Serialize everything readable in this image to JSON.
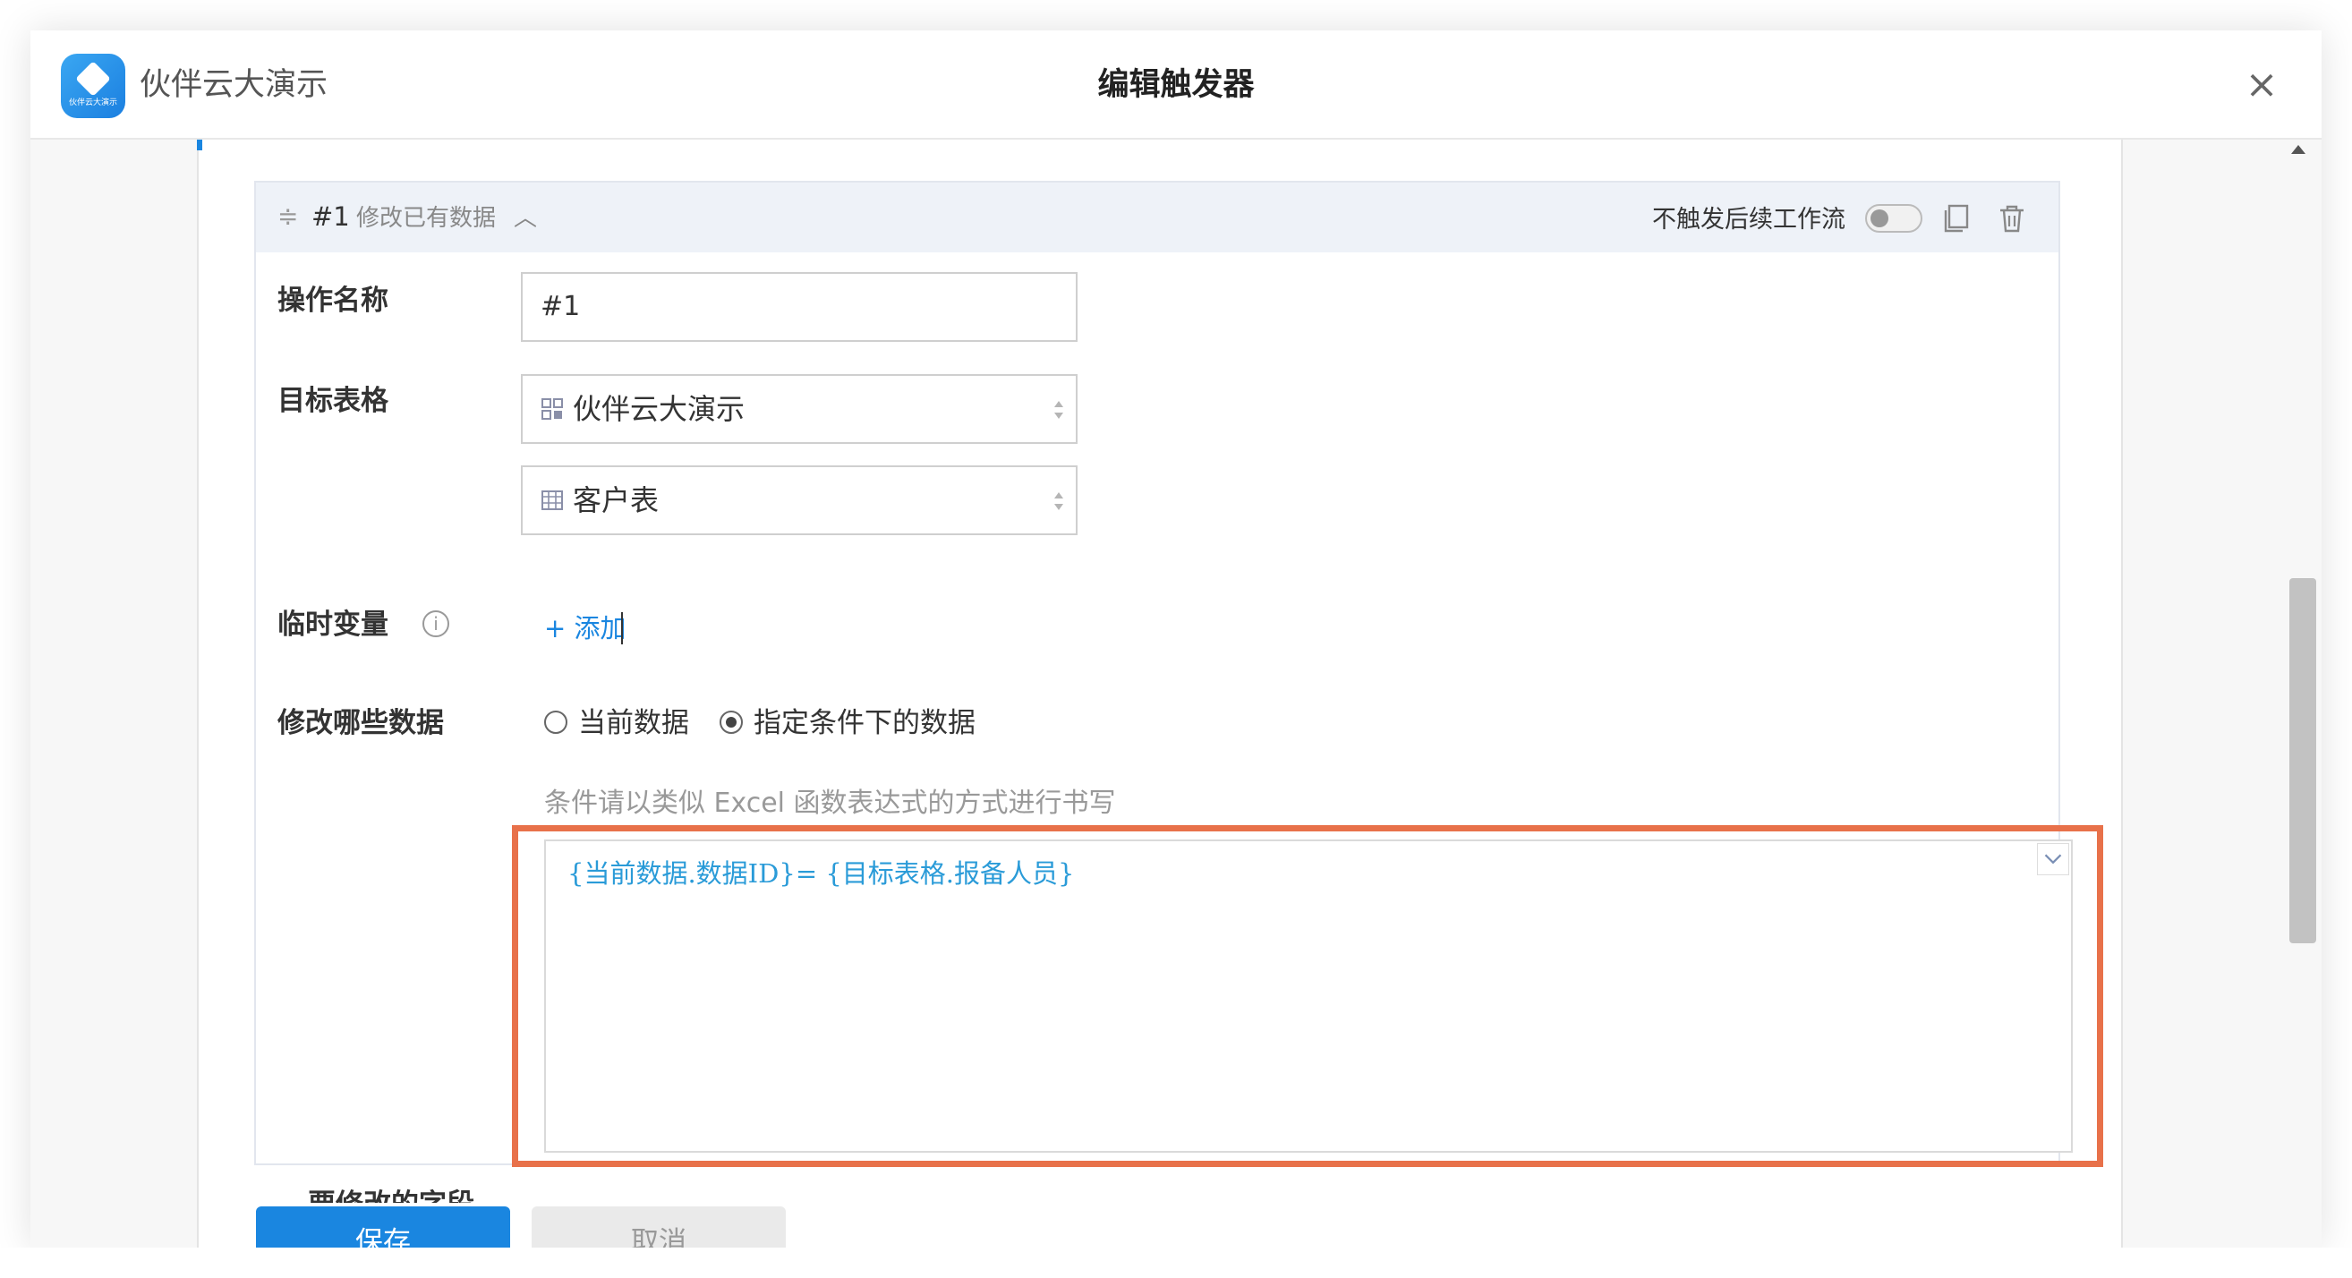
{
  "app": {
    "name": "伙伴云大演示",
    "logo_caption": "伙伴云大演示"
  },
  "dialog": {
    "title": "编辑触发器",
    "close_icon": "×"
  },
  "action_card": {
    "number": "#1",
    "type": "修改已有数据",
    "no_trigger_label": "不触发后续工作流",
    "no_trigger_enabled": false
  },
  "form": {
    "operation_name": {
      "label": "操作名称",
      "value": "#1"
    },
    "target_table": {
      "label": "目标表格",
      "workspace": "伙伴云大演示",
      "table": "客户表"
    },
    "temp_vars": {
      "label": "临时变量",
      "info": "i",
      "add": "+ 添加"
    },
    "which_data": {
      "label": "修改哪些数据",
      "options": [
        "当前数据",
        "指定条件下的数据"
      ],
      "selected": "指定条件下的数据"
    },
    "condition_hint": "条件请以类似 Excel 函数表达式的方式进行书写",
    "condition_expression": "{当前数据.数据ID}= {目标表格.报备人员}",
    "next_label": "要修改的字段"
  },
  "buttons": {
    "save": "保存",
    "cancel": "取消"
  },
  "colors": {
    "accent": "#1a86e0",
    "highlight": "#e8714a",
    "expression": "#2a9bd8"
  }
}
